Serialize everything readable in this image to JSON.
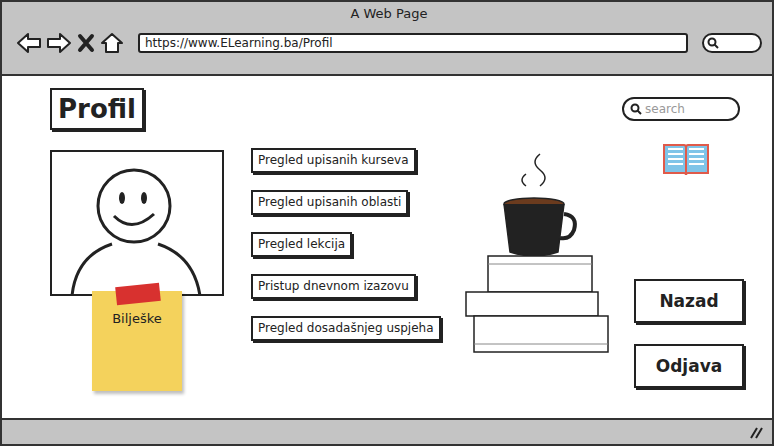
{
  "window": {
    "title": "A Web Page"
  },
  "address_bar": {
    "url": "https://www.ELearning.ba/Profil"
  },
  "page": {
    "heading": "Profil",
    "search": {
      "placeholder": "search"
    }
  },
  "menu": {
    "items": [
      "Pregled upisanih kurseva",
      "Pregled upisanih oblasti",
      "Pregled lekcija",
      "Pristup dnevnom izazovu",
      "Pregled dosadašnjeg uspjeha"
    ]
  },
  "note": {
    "label": "Bilješke"
  },
  "buttons": [
    "Nazad",
    "Odjava"
  ]
}
